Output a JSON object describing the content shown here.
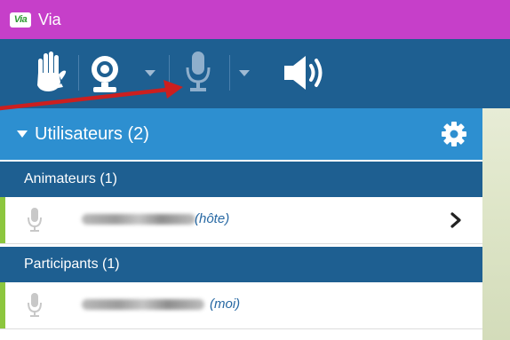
{
  "window": {
    "logo_text": "Via",
    "title": "Via"
  },
  "toolbar": {
    "icons": [
      "hand-raise-icon",
      "webcam-icon",
      "microphone-icon",
      "speaker-icon"
    ]
  },
  "users_panel": {
    "title": "Utilisateurs (2)",
    "sections": [
      {
        "label": "Animateurs (1)",
        "members": [
          {
            "role_label": "(hôte)",
            "status_color": "#8cc63e"
          }
        ]
      },
      {
        "label": "Participants (1)",
        "members": [
          {
            "role_label": "(moi)",
            "status_color": "#8cc63e"
          }
        ]
      }
    ]
  },
  "colors": {
    "titlebar": "#c63fc9",
    "toolbar": "#1e5f91",
    "users_header": "#2d8fd0",
    "section": "#1e5f91",
    "annotation_arrow": "#cc1f1f"
  }
}
